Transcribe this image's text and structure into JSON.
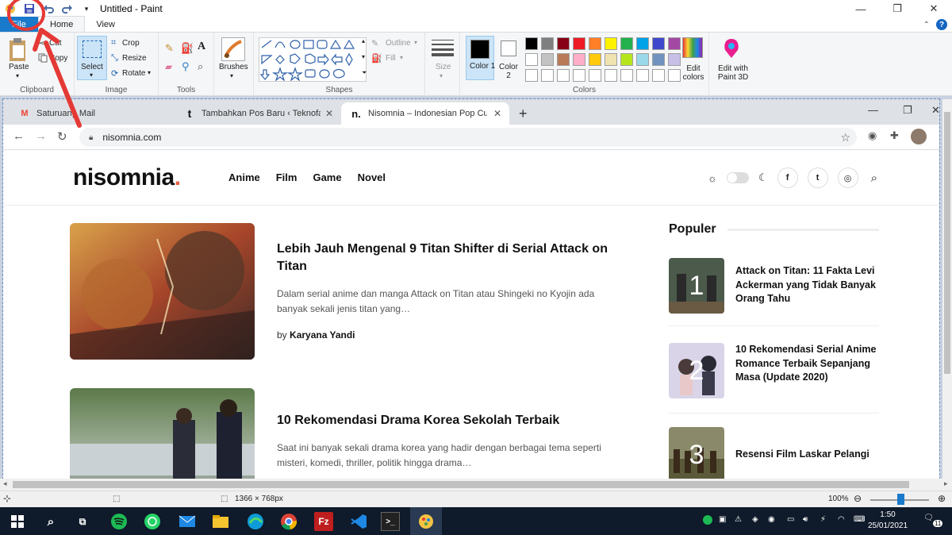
{
  "paint": {
    "window_title": "Untitled - Paint",
    "tabs": [
      "File",
      "Home",
      "View"
    ],
    "clipboard": {
      "paste": "Paste",
      "cut": "Cut",
      "copy": "Copy",
      "label": "Clipboard"
    },
    "image": {
      "select": "Select",
      "crop": "Crop",
      "resize": "Resize",
      "rotate": "Rotate",
      "label": "Image"
    },
    "tools": {
      "label": "Tools",
      "brushes": "Brushes"
    },
    "shapes": {
      "outline": "Outline",
      "fill": "Fill",
      "label": "Shapes"
    },
    "size": "Size",
    "colors": {
      "color1": "Color 1",
      "color2": "Color 2",
      "edit_colors": "Edit colors",
      "edit_paint3d": "Edit with Paint 3D",
      "label": "Colors",
      "palette": [
        "#000000",
        "#7f7f7f",
        "#880015",
        "#ed1c24",
        "#ff7f27",
        "#fff200",
        "#22b14c",
        "#00a2e8",
        "#3f48cc",
        "#a349a4",
        "#ffffff",
        "#c3c3c3",
        "#b97a57",
        "#ffaec9",
        "#ffc90e",
        "#efe4b0",
        "#b5e61d",
        "#99d9ea",
        "#7092be",
        "#c8bfe7",
        "#ffffff",
        "#ffffff",
        "#ffffff",
        "#ffffff",
        "#ffffff",
        "#ffffff",
        "#ffffff",
        "#ffffff",
        "#ffffff",
        "#ffffff"
      ]
    },
    "status": {
      "dimensions": "1366 × 768px",
      "zoom": "100%"
    }
  },
  "browser": {
    "tabs": [
      {
        "title": "Saturuang Mail",
        "favicon": "M"
      },
      {
        "title": "Tambahkan Pos Baru ‹ Teknofara",
        "favicon": "t"
      },
      {
        "title": "Nisomnia – Indonesian Pop Culture",
        "favicon": "n."
      }
    ],
    "url": "nisomnia.com"
  },
  "site": {
    "logo": "nisomnia",
    "logo_dot": ".",
    "nav": [
      "Anime",
      "Film",
      "Game",
      "Novel"
    ],
    "articles": [
      {
        "title": "Lebih Jauh Mengenal 9 Titan Shifter di Serial Attack on Titan",
        "excerpt": "Dalam serial anime dan manga Attack on Titan atau Shingeki no Kyojin ada banyak sekali jenis titan yang…",
        "by": "by",
        "author": "Karyana Yandi"
      },
      {
        "title": "10 Rekomendasi Drama Korea Sekolah Terbaik",
        "excerpt": "Saat ini banyak sekali drama korea yang hadir dengan berbagai tema seperti misteri, komedi, thriller, politik hingga drama…"
      }
    ],
    "sidebar": {
      "heading": "Populer",
      "items": [
        {
          "rank": "1",
          "title": "Attack on Titan: 11 Fakta Levi Ackerman yang Tidak Banyak Orang Tahu"
        },
        {
          "rank": "2",
          "title": "10 Rekomendasi Serial Anime Romance Terbaik Sepanjang Masa (Update 2020)"
        },
        {
          "rank": "3",
          "title": "Resensi Film Laskar Pelangi"
        }
      ]
    }
  },
  "taskbar": {
    "time": "1:50",
    "date": "25/01/2021",
    "notifications": "11"
  }
}
